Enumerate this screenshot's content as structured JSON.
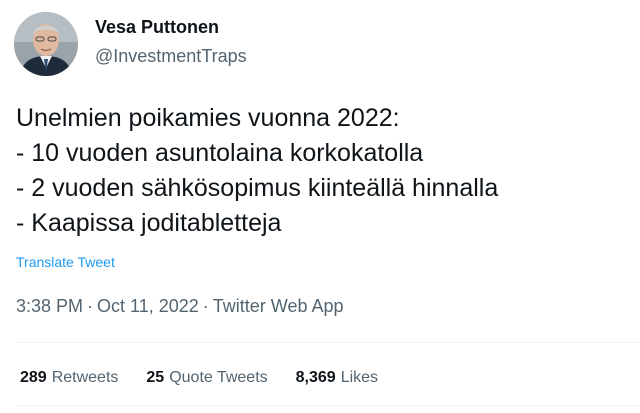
{
  "author": {
    "display_name": "Vesa Puttonen",
    "handle": "@InvestmentTraps"
  },
  "tweet": {
    "lines": [
      "Unelmien poikamies vuonna 2022:",
      "- 10 vuoden asuntolaina korkokatolla",
      "- 2 vuoden sähkösopimus kiinteällä hinnalla",
      "- Kaapissa joditabletteja"
    ],
    "translate_label": "Translate Tweet"
  },
  "meta": {
    "time": "3:38 PM",
    "separator": "·",
    "date": "Oct 11, 2022",
    "source": "Twitter Web App"
  },
  "stats": {
    "retweets": {
      "count": "289",
      "label": "Retweets"
    },
    "quote_tweets": {
      "count": "25",
      "label": "Quote Tweets"
    },
    "likes": {
      "count": "8,369",
      "label": "Likes"
    }
  },
  "colors": {
    "text_primary": "#0f1419",
    "text_secondary": "#536471",
    "link": "#1d9bf0",
    "divider": "#eff3f4"
  }
}
